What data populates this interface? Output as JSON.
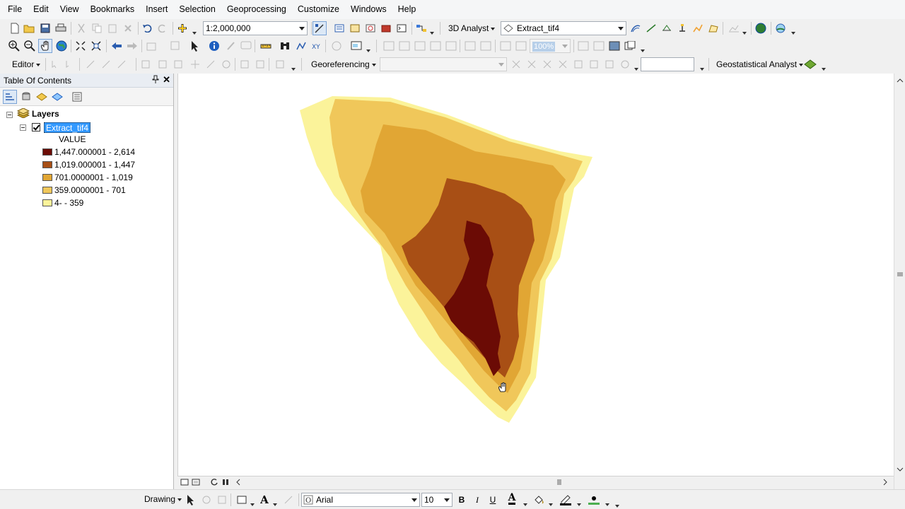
{
  "menubar": {
    "items": [
      "File",
      "Edit",
      "View",
      "Bookmarks",
      "Insert",
      "Selection",
      "Geoprocessing",
      "Customize",
      "Windows",
      "Help"
    ]
  },
  "standard_toolbar": {
    "scale": "1:2,000,000",
    "analyst_label": "3D Analyst",
    "layer_combo": "Extract_tif4"
  },
  "tools_toolbar": {
    "zoom_percent": "100%"
  },
  "third_toolbar": {
    "editor_label": "Editor",
    "georef_label": "Georeferencing",
    "geostat_label": "Geostatistical Analyst"
  },
  "toc": {
    "title": "Table Of Contents",
    "layers_label": "Layers",
    "layer_name": "Extract_tif4",
    "field_label": "VALUE",
    "legend": [
      {
        "label": "1,447.000001 - 2,614",
        "color": "#6b0b05"
      },
      {
        "label": "1,019.000001 - 1,447",
        "color": "#a84f15"
      },
      {
        "label": "701.0000001 - 1,019",
        "color": "#e1a634"
      },
      {
        "label": "359.0000001 - 701",
        "color": "#f0c75a"
      },
      {
        "label": "4- - 359",
        "color": "#fbf39a"
      }
    ]
  },
  "drawing_toolbar": {
    "drawing_label": "Drawing",
    "font_name": "Arial",
    "font_size": "10",
    "bold": "B",
    "italic": "I",
    "underline": "U",
    "text_tool": "A",
    "font_color": "A"
  },
  "colors": {
    "class1": "#6b0b05",
    "class2": "#a84f15",
    "class3": "#e1a634",
    "class4": "#f0c75a",
    "class5": "#fbf39a",
    "selection": "#3399ff"
  }
}
